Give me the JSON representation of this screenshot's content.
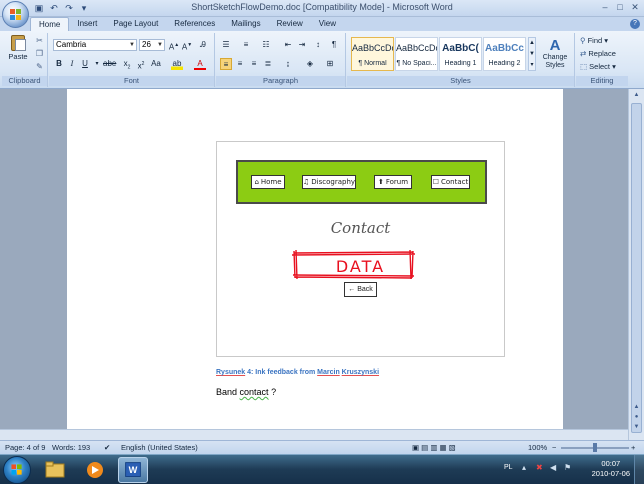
{
  "window": {
    "title": "ShortSketchFlowDemo.doc [Compatibility Mode] - Microsoft Word",
    "controls": [
      "minimize",
      "maximize",
      "close"
    ]
  },
  "tabs": [
    "Home",
    "Insert",
    "Page Layout",
    "References",
    "Mailings",
    "Review",
    "View"
  ],
  "ribbon": {
    "clipboard": {
      "paste_label": "Paste",
      "group_label": "Clipboard"
    },
    "font": {
      "font_name": "Cambria",
      "font_size": "26",
      "group_label": "Font"
    },
    "paragraph": {
      "group_label": "Paragraph"
    },
    "styles": {
      "group_label": "Styles",
      "items": [
        {
          "sample": "AaBbCcDc",
          "name": "¶ Normal"
        },
        {
          "sample": "AaBbCcDc",
          "name": "¶ No Spaci..."
        },
        {
          "sample": "AaBbC(",
          "name": "Heading 1"
        },
        {
          "sample": "AaBbCc",
          "name": "Heading 2"
        }
      ],
      "change_styles": "Change Styles"
    },
    "editing": {
      "find": "Find",
      "replace": "Replace",
      "select": "Select",
      "group_label": "Editing"
    }
  },
  "sketch": {
    "nav_buttons": [
      {
        "icon": "home-icon",
        "glyph": "⌂",
        "label": "Home"
      },
      {
        "icon": "music-icon",
        "glyph": "♫",
        "label": "Discography"
      },
      {
        "icon": "pin-icon",
        "glyph": "⬆",
        "label": "Forum"
      },
      {
        "icon": "contact-icon",
        "glyph": "☐",
        "label": "Contact"
      }
    ],
    "page_title": "Contact",
    "data_label": "DATA",
    "back_label": "Back",
    "nav_color": "#8ccc13",
    "data_color": "#e8101f"
  },
  "document": {
    "caption_prefix": "Rysunek",
    "caption_rest": " 4: Ink feedback from ",
    "caption_name1": "Marcin",
    "caption_space": " ",
    "caption_name2": "Kruszynski",
    "body_word1": "Band ",
    "body_word2": "contact",
    "body_word3": " ?"
  },
  "status": {
    "page": "Page: 4 of 9",
    "words": "Words: 193",
    "language": "English (United States)",
    "zoom": "100%"
  },
  "taskbar": {
    "input_lang": "PL",
    "time": "00:07",
    "date": "2010-07-06"
  },
  "colors": {
    "ribbon_bg": "#dbe7f6",
    "accent": "#4676b8",
    "selection": "#e6b84e"
  }
}
